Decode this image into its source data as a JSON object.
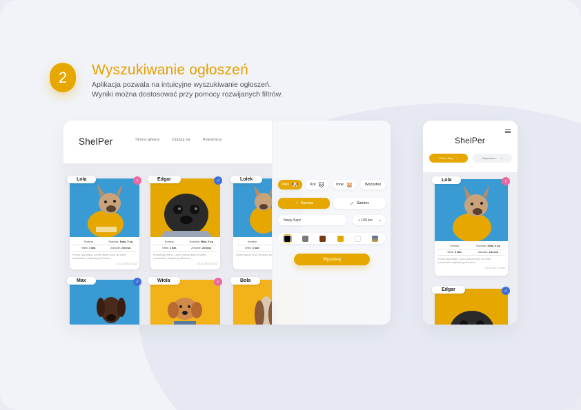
{
  "step_number": "2",
  "heading": "Wyszukiwanie ogłoszeń",
  "subtext": {
    "line1": "Aplikacja pozwala na intuicyjne wyszukiwanie ogłoszeń.",
    "line2": "Wyniki można dostosować przy pomocy rozwijanych filtrów."
  },
  "desktop": {
    "logo": "ShelPer",
    "nav": [
      "Strona główna",
      "Zaloguj się",
      "Rejestracja"
    ],
    "cards": [
      {
        "name": "Lola",
        "gender": "female",
        "breed": "Kreślna",
        "size_label": "Rozmiar:",
        "size_value": "Mała, 5 kg",
        "age_label": "Wiek:",
        "age_value": "3 lata",
        "health_label": "Zdrowie:",
        "health_value": "Zdrowa",
        "desc": "Pomoj zaly kasky. Lorem ipsum dolor sit amet, consectetur adipiscing elit lorem...",
        "date": "10.11.2021 13:02"
      },
      {
        "name": "Edgar",
        "gender": "male",
        "breed": "Kreślna",
        "size_label": "Rozmiar:",
        "size_value": "Mały, 5 kg",
        "age_label": "Wiek:",
        "age_value": "3 lata",
        "health_label": "Zdrowie:",
        "health_value": "Zdrowy",
        "desc": "Potrzebuje domu. Lorem ipsum dolor sit amet, consectetur adipiscing elit lorem...",
        "date": "10.11.2021 13:02"
      },
      {
        "name": "Lolek",
        "gender": "male",
        "breed": "Kreślna",
        "size_label": "",
        "size_value": "",
        "age_label": "Wiek:",
        "age_value": "3 lata",
        "health_label": "",
        "health_value": "",
        "desc": "Lorem ipsum dolor sit amet, consectetur adipis",
        "date": ""
      },
      {
        "name": "Max",
        "gender": "male"
      },
      {
        "name": "Wiola",
        "gender": "female"
      },
      {
        "name": "Bola",
        "gender": "female"
      }
    ],
    "filters": {
      "species": [
        {
          "label": "Pies",
          "emoji": "🐶"
        },
        {
          "label": "Kot",
          "emoji": "🐱"
        },
        {
          "label": "Inne",
          "emoji": "🐹"
        },
        {
          "label": "Wszystko",
          "emoji": ""
        }
      ],
      "female_label": "Samica",
      "male_label": "Samiec",
      "city_value": "Nowy Sącz",
      "distance_value": "+ 100 km",
      "colors": [
        "#000000",
        "#7a7a7a",
        "#7b3a10",
        "#e6a800",
        "#ffffff",
        "#c9a040"
      ],
      "search_button": "Wyszukaj"
    }
  },
  "mobile": {
    "logo": "ShelPer",
    "filter_button": "Pokaż filtry",
    "sort_label": "Najnowsze",
    "cards": [
      {
        "name": "Lola",
        "gender": "female",
        "breed": "Kreślna",
        "size_label": "Rozmiar:",
        "size_value": "Mała, 5 kg",
        "age_label": "Wiek:",
        "age_value": "3 lata",
        "health_label": "Zdrowie:",
        "health_value": "Zdrowa",
        "desc": "Pomoj zaly kasky. Lorem ipsum dolor sit amet, consectetur adipiscing elit lorem...",
        "date": "10.11.2021 13:02"
      },
      {
        "name": "Edgar",
        "gender": "male"
      }
    ]
  },
  "colors": {
    "accent": "#e6a800",
    "female": "#e96aa0",
    "male": "#3f6fd6"
  }
}
